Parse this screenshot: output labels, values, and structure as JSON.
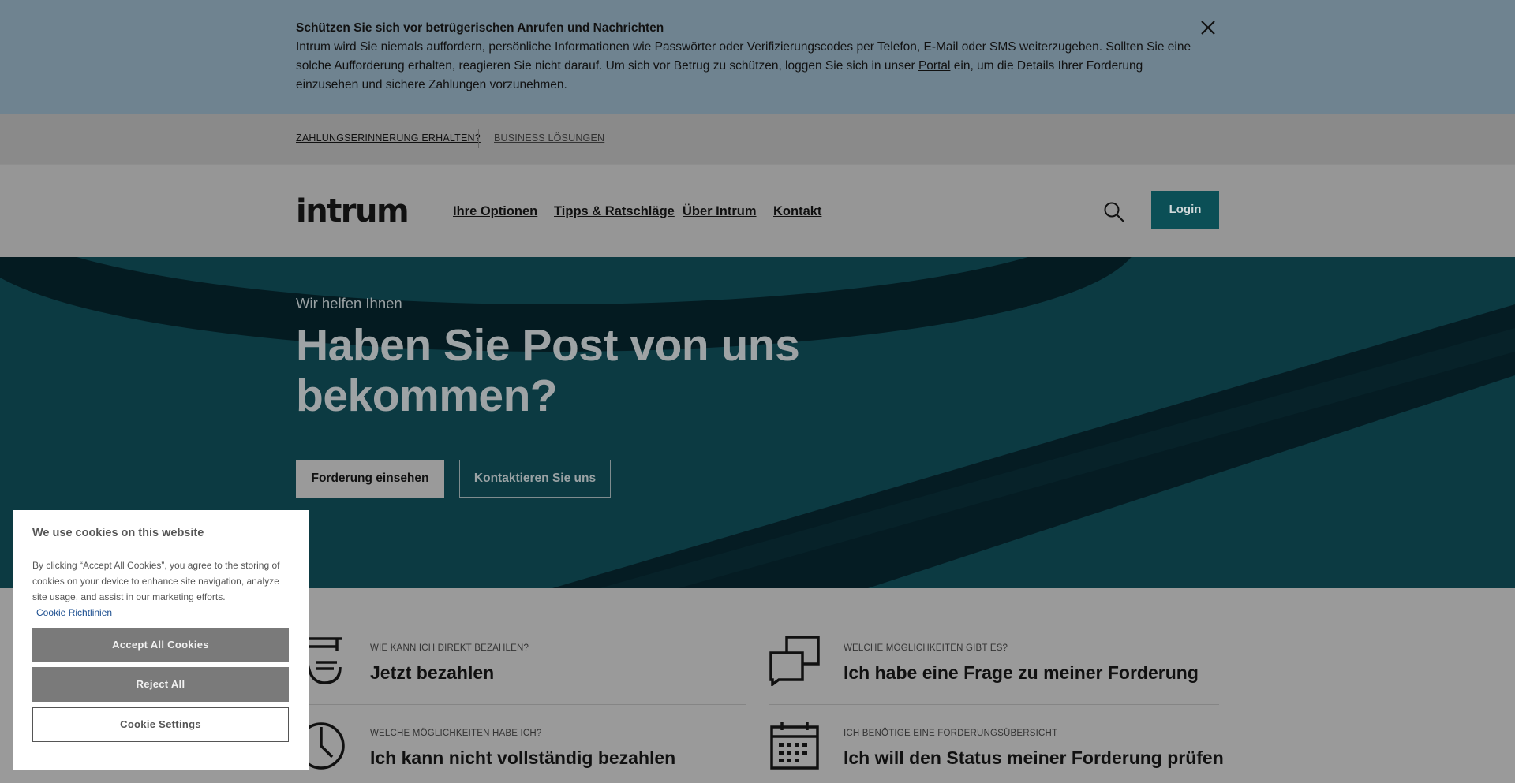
{
  "alert": {
    "title": "Schützen Sie sich vor betrügerischen Anrufen und Nachrichten",
    "body_before": "Intrum wird Sie niemals auffordern, persönliche Informationen wie Passwörter oder Verifizierungscodes per Telefon, E-Mail oder SMS weiterzugeben. Sollten Sie eine solche Aufforderung erhalten, reagieren Sie nicht darauf. Um sich vor Betrug zu schützen, loggen Sie sich in unser ",
    "portal_link": "Portal",
    "body_after": " ein, um die Details Ihrer Forderung einzusehen und sichere Zahlungen vorzunehmen.",
    "close_icon": "close-icon"
  },
  "utility_nav": {
    "items": [
      "ZAHLUNGSERINNERUNG ERHALTEN?",
      "BUSINESS LÖSUNGEN"
    ]
  },
  "header": {
    "logo": "intrum",
    "nav": [
      "Ihre Optionen",
      "Tipps & Ratschläge",
      "Über Intrum",
      "Kontakt"
    ],
    "search_icon": "search-icon",
    "login": "Login"
  },
  "hero": {
    "eyebrow": "Wir helfen Ihnen",
    "title": "Haben Sie Post von uns bekommen?",
    "primary_button": "Forderung einsehen",
    "secondary_button": "Kontaktieren Sie uns"
  },
  "options": [
    {
      "eyebrow": "WIE KANN ICH DIREKT BEZAHLEN?",
      "title": "Jetzt bezahlen",
      "icon": "payment-terminal-icon"
    },
    {
      "eyebrow": "WELCHE MÖGLICHKEITEN GIBT ES?",
      "title": "Ich habe eine Frage zu meiner Forderung",
      "icon": "chat-bubbles-icon"
    },
    {
      "eyebrow": "WELCHE MÖGLICHKEITEN HABE ICH?",
      "title": "Ich kann nicht vollständig bezahlen",
      "icon": "clock-icon"
    },
    {
      "eyebrow": "ICH BENÖTIGE EINE FORDERUNGSÜBERSICHT",
      "title": "Ich will den Status meiner Forderung prüfen",
      "icon": "calendar-icon"
    }
  ],
  "cookie": {
    "title": "We use cookies on this website",
    "text": "By clicking “Accept All Cookies”, you agree to the storing of cookies on your device to enhance site navigation, analyze site usage, and assist in our marketing efforts.",
    "policy_link": "Cookie Richtlinien",
    "accept": "Accept All Cookies",
    "reject": "Reject All",
    "settings": "Cookie Settings"
  },
  "colors": {
    "brand_teal": "#0b4f56",
    "hero_bg": "#0c3a42",
    "overlay_gray": "#9a9a9a"
  }
}
